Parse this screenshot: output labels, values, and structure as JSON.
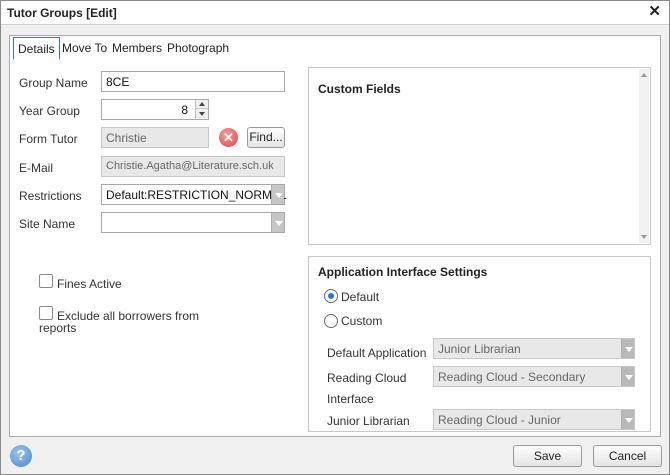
{
  "window": {
    "title": "Tutor Groups [Edit]"
  },
  "tabs": [
    {
      "label": "Details"
    },
    {
      "label": "Move To"
    },
    {
      "label": "Members"
    },
    {
      "label": "Photograph"
    }
  ],
  "form": {
    "group_name": {
      "label": "Group Name",
      "value": "8CE"
    },
    "year_group": {
      "label": "Year Group",
      "value": "8"
    },
    "form_tutor": {
      "label": "Form Tutor",
      "value": "Christie",
      "find_label": "Find..."
    },
    "email": {
      "label": "E-Mail",
      "value": "Christie.Agatha@Literature.sch.uk"
    },
    "restrictions": {
      "label": "Restrictions",
      "value": "Default:RESTRICTION_NORMAL"
    },
    "site_name": {
      "label": "Site Name",
      "value": ""
    },
    "fines_active": {
      "label": "Fines Active",
      "checked": false
    },
    "exclude_borrowers": {
      "label_line1": "Exclude all borrowers from",
      "label_line2": "reports",
      "checked": false
    }
  },
  "custom_fields": {
    "title": "Custom Fields"
  },
  "app_interface": {
    "title": "Application Interface Settings",
    "radio_default": {
      "label": "Default",
      "checked": true
    },
    "radio_custom": {
      "label": "Custom",
      "checked": false
    },
    "default_application": {
      "label": "Default Application",
      "value": "Junior Librarian"
    },
    "reading_cloud_interface": {
      "label_line1": "Reading Cloud",
      "label_line2": "Interface",
      "value": "Reading Cloud - Secondary"
    },
    "junior_librarian": {
      "label": "Junior Librarian",
      "value": "Reading Cloud - Junior"
    }
  },
  "footer": {
    "save_label": "Save",
    "cancel_label": "Cancel"
  },
  "icons": {
    "close": "close-icon",
    "help": "help-icon",
    "clear": "clear-icon",
    "dropdown": "chevron-down-icon"
  },
  "colors": {
    "accent": "#2b78c8",
    "clear_icon": "#d9443f",
    "help_icon": "#4a86c8"
  }
}
